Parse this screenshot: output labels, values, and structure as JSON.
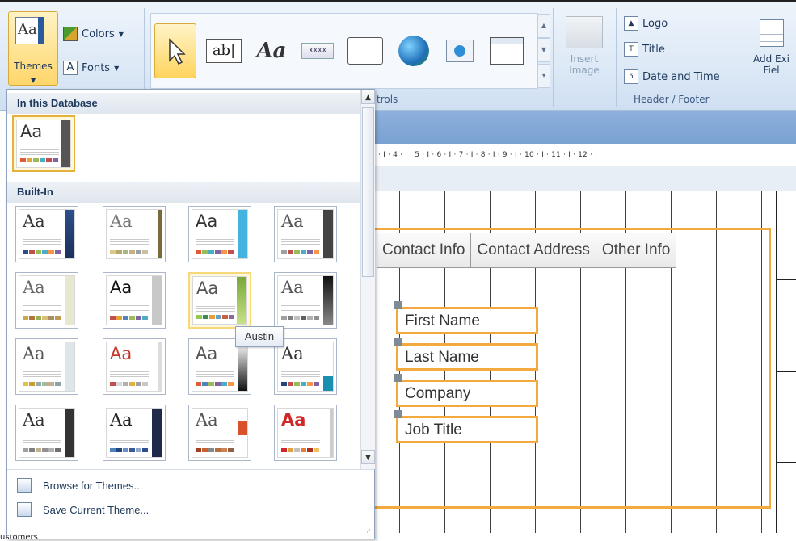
{
  "ribbon": {
    "themes_label": "Themes",
    "themes_icon_text": "Aa",
    "colors_label": "Colors",
    "fonts_label": "Fonts",
    "controls_group_label": "trols",
    "insert_image_label_1": "Insert",
    "insert_image_label_2": "Image",
    "header_footer": {
      "logo_label": "Logo",
      "title_label": "Title",
      "date_time_label": "Date and Time",
      "group_label": "Header / Footer"
    },
    "add_fields_label_1": "Add Exi",
    "add_fields_label_2": "Fiel",
    "controls": [
      {
        "icon": "pointer-icon",
        "glyph": "↖"
      },
      {
        "icon": "textbox-icon",
        "glyph": "ab|"
      },
      {
        "icon": "label-icon",
        "glyph": "Aa"
      },
      {
        "icon": "button-icon",
        "glyph": "XXXX"
      },
      {
        "icon": "tab-control-icon",
        "glyph": ""
      },
      {
        "icon": "hyperlink-icon",
        "glyph": "◍"
      },
      {
        "icon": "web-browser-icon",
        "glyph": "◉"
      },
      {
        "icon": "navigation-icon",
        "glyph": ""
      }
    ]
  },
  "dropdown": {
    "section_in_db": "In this Database",
    "section_builtin": "Built-In",
    "tooltip": "Austin",
    "browse_label": "Browse for Themes...",
    "save_label": "Save Current Theme...",
    "thumb_text": "Aa"
  },
  "ruler": {
    "text": "· I · 4 · I · 5 · I · 6 · I · 7 · I · 8 · I · 9 · I · 10 · I · 11 · I · 12 · I"
  },
  "form": {
    "tabs": [
      "Contact Info",
      "Contact Address",
      "Other Info"
    ],
    "fields": [
      "First Name",
      "Last Name",
      "Company",
      "Job Title"
    ]
  },
  "status": {
    "partial_text": "ustomers"
  },
  "colors": {
    "accent_orange": "#f3a93e",
    "ribbon_blue": "#dde9f6",
    "highlight_yellow": "#ffd66b"
  }
}
